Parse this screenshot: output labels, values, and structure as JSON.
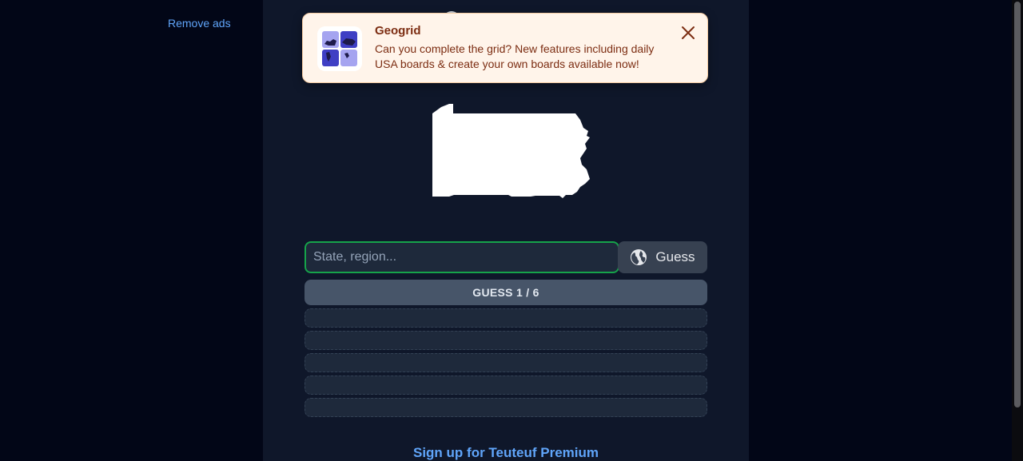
{
  "sidebar": {
    "remove_ads_label": "Remove ads"
  },
  "game": {
    "input_placeholder": "State, region...",
    "input_value": "",
    "guess_button_label": "Guess",
    "guess_counter": "GUESS 1 / 6",
    "empty_guess_slots": 5,
    "premium_link": "Sign up for Teuteuf Premium"
  },
  "toast": {
    "title": "Geogrid",
    "message": "Can you complete the grid? New features including daily USA boards & create your own boards available now!",
    "icon": "geogrid-app-icon",
    "close_icon": "close-icon"
  },
  "icons": {
    "guess_button_icon": "globe-icon",
    "header_logo_icon": "globe-icon"
  },
  "colors": {
    "page_background": "#020617",
    "column_background": "#0f172a",
    "input_border_active": "#16a34a",
    "link": "#60a5fa",
    "toast_background": "#fff4ea",
    "toast_text": "#7c2d12",
    "counter_background": "#475569"
  }
}
